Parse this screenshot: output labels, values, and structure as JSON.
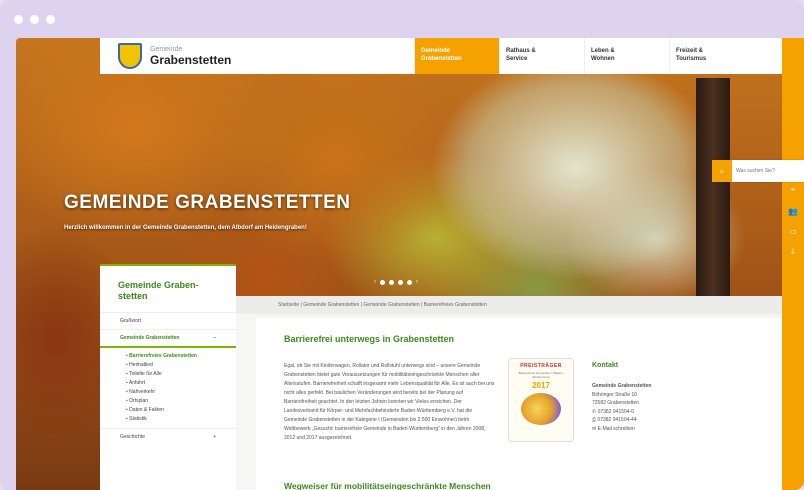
{
  "site": {
    "brand_small": "Gemeinde",
    "brand_name": "Grabenstetten"
  },
  "nav": [
    {
      "line1": "Gemeinde",
      "line2": "Grabenstetten",
      "active": true
    },
    {
      "line1": "Rathaus &",
      "line2": "Service"
    },
    {
      "line1": "Leben &",
      "line2": "Wohnen"
    },
    {
      "line1": "Freizeit &",
      "line2": "Tourismus"
    }
  ],
  "search": {
    "placeholder": "Was suchen Sie?",
    "icon": "search-icon"
  },
  "rail_icons": [
    "location-pin-icon",
    "people-icon",
    "credit-card-icon",
    "download-icon"
  ],
  "hero": {
    "title": "GEMEINDE GRABENSTETTEN",
    "subtitle": "Herzlich willkommen in der Gemeinde Grabenstetten, dem Albdorf am Heidengraben!"
  },
  "sidebar": {
    "title": "Gemeinde Graben-stetten",
    "items": [
      "Grußwort",
      "Gemeinde Grabenstetten",
      "Geschichte"
    ],
    "subitems": [
      "Barrierefreies Grabenstetten",
      "Heimatlied",
      "Toilette für Alle",
      "Anfahrt",
      "Nahverkehr",
      "Ortsplan",
      "Daten & Fakten",
      "Statistik"
    ]
  },
  "breadcrumb": "Startseite | Gemeinde Grabenstetten | Gemeinde Grabenstetten | Barrierefreies Grabenstetten",
  "article": {
    "heading": "Barrierefrei unterwegs in Grabenstetten",
    "paragraph": "Egal, ob Sie mit Kinderwagen, Rollator und Rollstuhl unterwegs sind – unsere Gemeinde Grabenstetten bietet gute Voraussetzungen für mobilitätseingeschränkte Menschen aller Altersstufen. Barrierefreiheit schafft insgesamt mehr Lebensqualität für Alle. Es ist auch bei uns nicht alles perfekt. Bei baulichen Veränderungen wird bereits bei der Planung auf Barrierefreiheit geachtet. In den letzten Jahren konnten wir Vieles erreichen. Der Landesverband für Körper- und Mehrfachbehinderte Baden-Württemberg e.V. hat die Gemeinde Grabenstetten in der Kategorie I (Gemeinden bis 2.500 Einwohner) beim Wettbewerb „Gesucht: barrierefreie Gemeinde in Baden-Württemberg“ in den Jahren 2008, 2012 und 2017 ausgezeichnet.",
    "award_title": "PREISTRÄGER",
    "award_text": "Barrierefreie Gemeinde in Baden-Württemberg",
    "award_year": "2017",
    "subheading": "Wegweiser für mobilitätseingeschränkte Menschen"
  },
  "contact": {
    "title": "Kontakt",
    "name": "Gemeinde Grabenstetten",
    "street": "Böhringer Straße 10",
    "city": "72582 Grabenstetten",
    "phone": "07382 941504-0",
    "fax": "07382 941504-44",
    "email_label": "E-Mail schreiben"
  },
  "colors": {
    "accent": "#f5a200",
    "green": "#3d8a1e"
  }
}
